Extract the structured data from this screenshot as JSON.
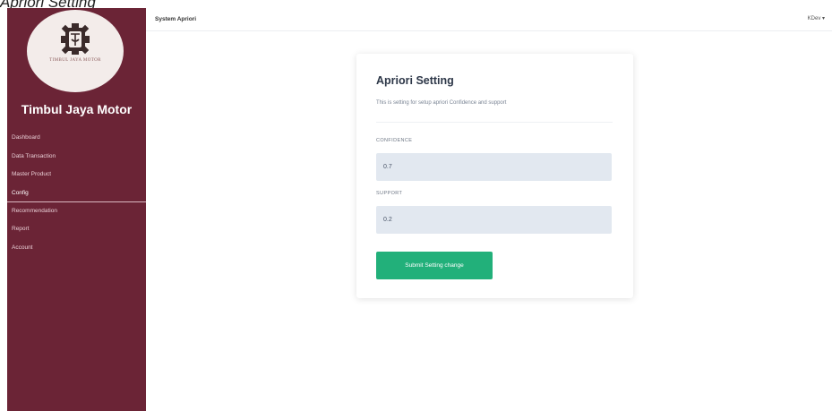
{
  "caption": "Apriori Setting",
  "sidebar": {
    "logo_text": "TIMBUL JAYA MOTOR",
    "brand": "Timbul Jaya Motor",
    "items": [
      {
        "label": "Dashboard"
      },
      {
        "label": "Data Transaction"
      },
      {
        "label": "Master Product"
      },
      {
        "label": "Config"
      },
      {
        "label": "Recommendation"
      },
      {
        "label": "Report"
      },
      {
        "label": "Account"
      }
    ]
  },
  "topbar": {
    "title": "System Apriori",
    "user": "KDev ▾"
  },
  "card": {
    "title": "Apriori Setting",
    "description": "This is setting for setup apriori Confidence and support",
    "confidence_label": "CONFIDENCE",
    "confidence_value": "0.7",
    "support_label": "SUPPORT",
    "support_value": "0.2",
    "submit_label": "Submit Setting change"
  },
  "colors": {
    "sidebar": "#6b2436",
    "accent": "#22b07a",
    "input_bg": "#e2e8f0"
  }
}
